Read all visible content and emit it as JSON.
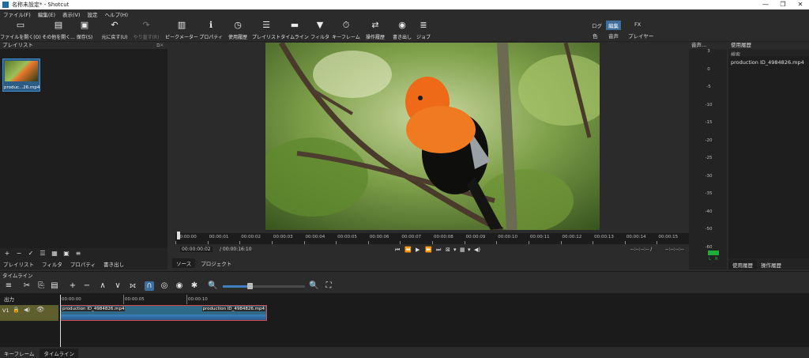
{
  "window": {
    "title": "名称未設定* - Shotcut",
    "controls": [
      "—",
      "❐",
      "✕"
    ]
  },
  "menu": [
    "ファイル(F)",
    "編集(E)",
    "表示(V)",
    "設定",
    "ヘルプ(H)"
  ],
  "toolbar": {
    "buttons": [
      {
        "label": "ファイルを開く(O)",
        "icon": "folder-open-icon",
        "glyph": "▭"
      },
      {
        "label": "その他を開く...",
        "icon": "folder-more-icon",
        "glyph": "▤"
      },
      {
        "label": "保存(S)",
        "icon": "save-icon",
        "glyph": "▣"
      },
      {
        "label": "元に戻す(U)",
        "icon": "undo-icon",
        "glyph": "↶"
      },
      {
        "label": "やり直す(R)",
        "icon": "redo-icon",
        "glyph": "↷"
      },
      {
        "label": "ピークメーター",
        "icon": "peak-meter-icon",
        "glyph": "▥"
      },
      {
        "label": "プロパティ",
        "icon": "properties-icon",
        "glyph": "ℹ"
      },
      {
        "label": "使用履歴",
        "icon": "history-icon",
        "glyph": "◷"
      },
      {
        "label": "プレイリスト",
        "icon": "playlist-icon",
        "glyph": "☰"
      },
      {
        "label": "タイムライン",
        "icon": "timeline-icon",
        "glyph": "▬"
      },
      {
        "label": "フィルタ",
        "icon": "filter-icon",
        "glyph": "▼"
      },
      {
        "label": "キーフレーム",
        "icon": "keyframe-icon",
        "glyph": "⏱"
      },
      {
        "label": "操作履歴",
        "icon": "action-history-icon",
        "glyph": "⇄"
      },
      {
        "label": "書き出し",
        "icon": "export-icon",
        "glyph": "◉"
      },
      {
        "label": "ジョブ",
        "icon": "jobs-icon",
        "glyph": "≣"
      }
    ],
    "layout_toggles": [
      {
        "label": "ログ",
        "active": false
      },
      {
        "label": "編集",
        "active": true
      },
      {
        "label": "FX",
        "active": false
      },
      {
        "label": "色",
        "active": false
      },
      {
        "label": "音声",
        "active": false
      },
      {
        "label": "プレイヤー",
        "active": false
      }
    ]
  },
  "playlist": {
    "title": "プレイリスト",
    "item_label": "produc...26.mp4",
    "tool_icons": [
      "add-icon",
      "remove-icon",
      "check-icon",
      "list-view-icon",
      "grid-view-icon",
      "tiles-view-icon",
      "menu-icon"
    ],
    "tool_glyphs": [
      "+",
      "−",
      "✓",
      "☰",
      "▦",
      "▣",
      "≡"
    ],
    "tabs": [
      "プレイリスト",
      "フィルタ",
      "プロパティ",
      "書き出し"
    ]
  },
  "player": {
    "ruler_labels": [
      "00:00:00",
      "00:00:01",
      "00:00:02",
      "00:00:03",
      "00:00:04",
      "00:00:05",
      "00:00:06",
      "00:00:07",
      "00:00:08",
      "00:00:09",
      "00:00:10",
      "00:00:11",
      "00:00:12",
      "00:00:13",
      "00:00:14",
      "00:00:15"
    ],
    "current_time": "00:00:00:02",
    "duration": "/ 00:00:16:10",
    "in_point": "--:--:--:-- /",
    "out_point": "--:--:--:--",
    "transport_glyphs": [
      "⏮",
      "⏪",
      "▶",
      "⏩",
      "⏭",
      "⊠",
      "▾",
      "▦",
      "▾",
      "◀)"
    ],
    "tabs": [
      "ソース",
      "プロジェクト"
    ],
    "active_tab": "ソース"
  },
  "audio_meter": {
    "title": "音声...",
    "scale": [
      "3",
      "0",
      "-5",
      "-10",
      "-15",
      "-20",
      "-25",
      "-30",
      "-35",
      "-40",
      "-50",
      "-60"
    ],
    "channels": [
      "L",
      "R"
    ]
  },
  "history": {
    "title": "使用履歴",
    "search_placeholder": "検索",
    "items": [
      "production ID_4984826.mp4"
    ],
    "tabs": [
      "使用履歴",
      "操作履歴"
    ],
    "active_tab": "使用履歴"
  },
  "timeline": {
    "title": "タイムライン",
    "tool_glyphs": [
      "≡",
      "✂",
      "⎘",
      "▤",
      "+",
      "−",
      "∧",
      "∨",
      "⟗",
      "∩",
      "◎",
      "◉",
      "✱",
      "🔍",
      "🔍",
      "⛶"
    ],
    "tool_icons": [
      "menu-icon",
      "cut-icon",
      "copy-icon",
      "paste-icon",
      "append-icon",
      "remove-icon",
      "lift-icon",
      "overwrite-icon",
      "split-icon",
      "snap-icon",
      "scrub-icon",
      "ripple-icon",
      "ripple-all-icon",
      "zoom-out-icon",
      "zoom-in-icon",
      "zoom-fit-icon"
    ],
    "zoom_level": 0.33,
    "output_label": "出力",
    "ruler_labels": [
      "00:00:00",
      "00:00:05",
      "00:00:10"
    ],
    "track": {
      "name": "V1",
      "icons": [
        "lock-icon",
        "mute-icon",
        "eye-icon"
      ],
      "glyphs": [
        "🔒",
        "◀)",
        "👁"
      ]
    },
    "clip_labels": [
      "production ID_4984826.mp4",
      "production ID_4984826.mp4"
    ],
    "bottom_tabs": [
      "キーフレーム",
      "タイムライン"
    ],
    "active_bottom_tab": "タイムライン"
  },
  "colors": {
    "accent": "#3d6e9e",
    "clip_border": "#d24a4a",
    "meter_green": "#1fae3a",
    "track_header": "#5e5e2e"
  }
}
